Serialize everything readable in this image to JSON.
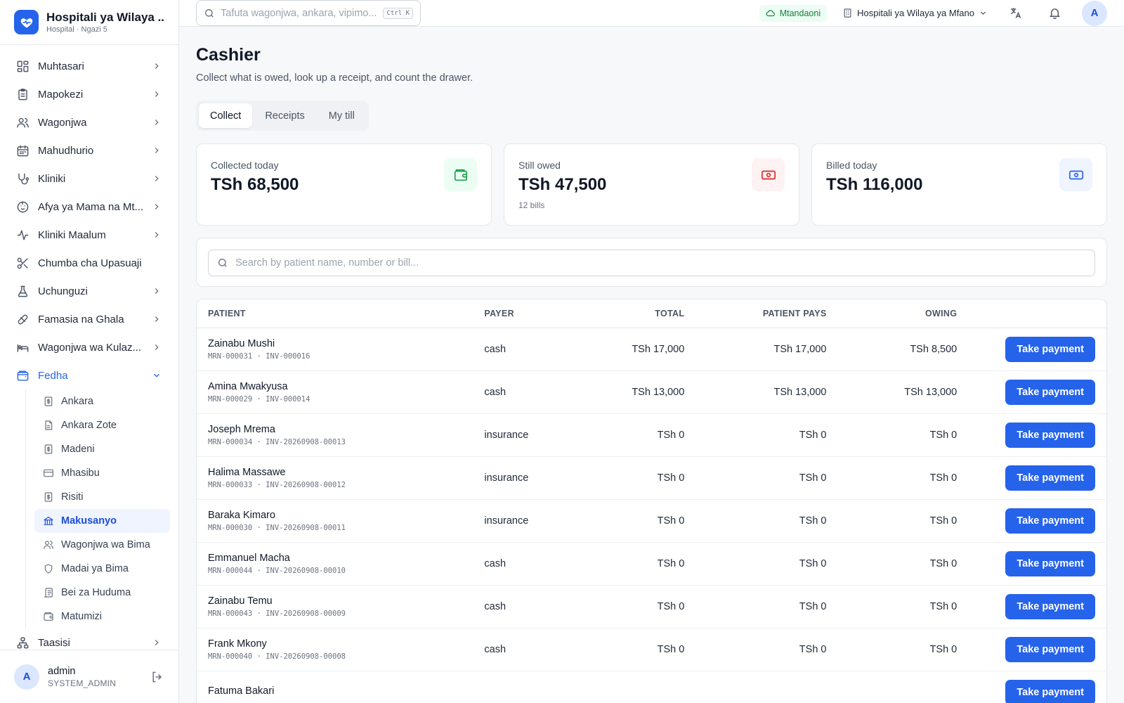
{
  "brand": {
    "title": "Hospitali ya Wilaya ...",
    "subtitle": "Hospital · Ngazi 5"
  },
  "nav": [
    {
      "label": "Muhtasari",
      "icon": "dashboard-icon",
      "chevron": "right"
    },
    {
      "label": "Mapokezi",
      "icon": "clipboard-icon",
      "chevron": "right"
    },
    {
      "label": "Wagonjwa",
      "icon": "users-icon",
      "chevron": "right"
    },
    {
      "label": "Mahudhurio",
      "icon": "calendar-icon",
      "chevron": "right"
    },
    {
      "label": "Kliniki",
      "icon": "stethoscope-icon",
      "chevron": "right"
    },
    {
      "label": "Afya ya Mama na Mt...",
      "icon": "baby-icon",
      "chevron": "right"
    },
    {
      "label": "Kliniki Maalum",
      "icon": "activity-icon",
      "chevron": "right"
    },
    {
      "label": "Chumba cha Upasuaji",
      "icon": "scissors-icon",
      "chevron": ""
    },
    {
      "label": "Uchunguzi",
      "icon": "flask-icon",
      "chevron": "right"
    },
    {
      "label": "Famasia na Ghala",
      "icon": "pill-icon",
      "chevron": "right"
    },
    {
      "label": "Wagonjwa wa Kulaz...",
      "icon": "bed-icon",
      "chevron": "right"
    }
  ],
  "finance": {
    "label": "Fedha",
    "items": [
      {
        "label": "Ankara",
        "icon": "invoice-icon"
      },
      {
        "label": "Ankara Zote",
        "icon": "file-icon"
      },
      {
        "label": "Madeni",
        "icon": "receipt-icon"
      },
      {
        "label": "Mhasibu",
        "icon": "card-icon"
      },
      {
        "label": "Risiti",
        "icon": "receipt-icon"
      },
      {
        "label": "Makusanyo",
        "icon": "bank-icon",
        "active": true
      },
      {
        "label": "Wagonjwa wa Bima",
        "icon": "users-icon"
      },
      {
        "label": "Madai ya Bima",
        "icon": "shield-icon"
      },
      {
        "label": "Bei za Huduma",
        "icon": "scroll-icon"
      },
      {
        "label": "Matumizi",
        "icon": "wallet-icon"
      }
    ]
  },
  "nav_after": {
    "label": "Taasisi",
    "icon": "network-icon"
  },
  "user": {
    "initial": "A",
    "name": "admin",
    "role": "SYSTEM_ADMIN"
  },
  "topbar": {
    "search_placeholder": "Tafuta wagonjwa, ankara, vipimo...",
    "shortcut": "Ctrl K",
    "status": "Mtandaoni",
    "facility": "Hospitali ya Wilaya ya Mfano",
    "avatar": "A"
  },
  "page": {
    "title": "Cashier",
    "subtitle": "Collect what is owed, look up a receipt, and count the drawer."
  },
  "tabs": [
    "Collect",
    "Receipts",
    "My till"
  ],
  "stats": {
    "collected": {
      "label": "Collected today",
      "value": "TSh 68,500"
    },
    "owed": {
      "label": "Still owed",
      "value": "TSh 47,500",
      "note": "12 bills"
    },
    "billed": {
      "label": "Billed today",
      "value": "TSh 116,000"
    }
  },
  "search_bills_placeholder": "Search by patient name, number or bill...",
  "table": {
    "headers": {
      "patient": "Patient",
      "payer": "Payer",
      "total": "Total",
      "patient_pays": "Patient pays",
      "owing": "Owing"
    },
    "action_label": "Take payment",
    "rows": [
      {
        "name": "Zainabu Mushi",
        "meta": "MRN-000031 · INV-000016",
        "payer": "cash",
        "total": "TSh 17,000",
        "pays": "TSh 17,000",
        "owing": "TSh 8,500"
      },
      {
        "name": "Amina Mwakyusa",
        "meta": "MRN-000029 · INV-000014",
        "payer": "cash",
        "total": "TSh 13,000",
        "pays": "TSh 13,000",
        "owing": "TSh 13,000"
      },
      {
        "name": "Joseph Mrema",
        "meta": "MRN-000034 · INV-20260908-00013",
        "payer": "insurance",
        "total": "TSh 0",
        "pays": "TSh 0",
        "owing": "TSh 0"
      },
      {
        "name": "Halima Massawe",
        "meta": "MRN-000033 · INV-20260908-00012",
        "payer": "insurance",
        "total": "TSh 0",
        "pays": "TSh 0",
        "owing": "TSh 0"
      },
      {
        "name": "Baraka Kimaro",
        "meta": "MRN-000030 · INV-20260908-00011",
        "payer": "insurance",
        "total": "TSh 0",
        "pays": "TSh 0",
        "owing": "TSh 0"
      },
      {
        "name": "Emmanuel Macha",
        "meta": "MRN-000044 · INV-20260908-00010",
        "payer": "cash",
        "total": "TSh 0",
        "pays": "TSh 0",
        "owing": "TSh 0"
      },
      {
        "name": "Zainabu Temu",
        "meta": "MRN-000043 · INV-20260908-00009",
        "payer": "cash",
        "total": "TSh 0",
        "pays": "TSh 0",
        "owing": "TSh 0"
      },
      {
        "name": "Frank Mkony",
        "meta": "MRN-000040 · INV-20260908-00008",
        "payer": "cash",
        "total": "TSh 0",
        "pays": "TSh 0",
        "owing": "TSh 0"
      },
      {
        "name": "Fatuma Bakari",
        "meta": "",
        "payer": "",
        "total": "",
        "pays": "",
        "owing": ""
      }
    ]
  },
  "colors": {
    "primary": "#2563eb",
    "online_bg": "#ecfdf3",
    "online_fg": "#15803d"
  }
}
